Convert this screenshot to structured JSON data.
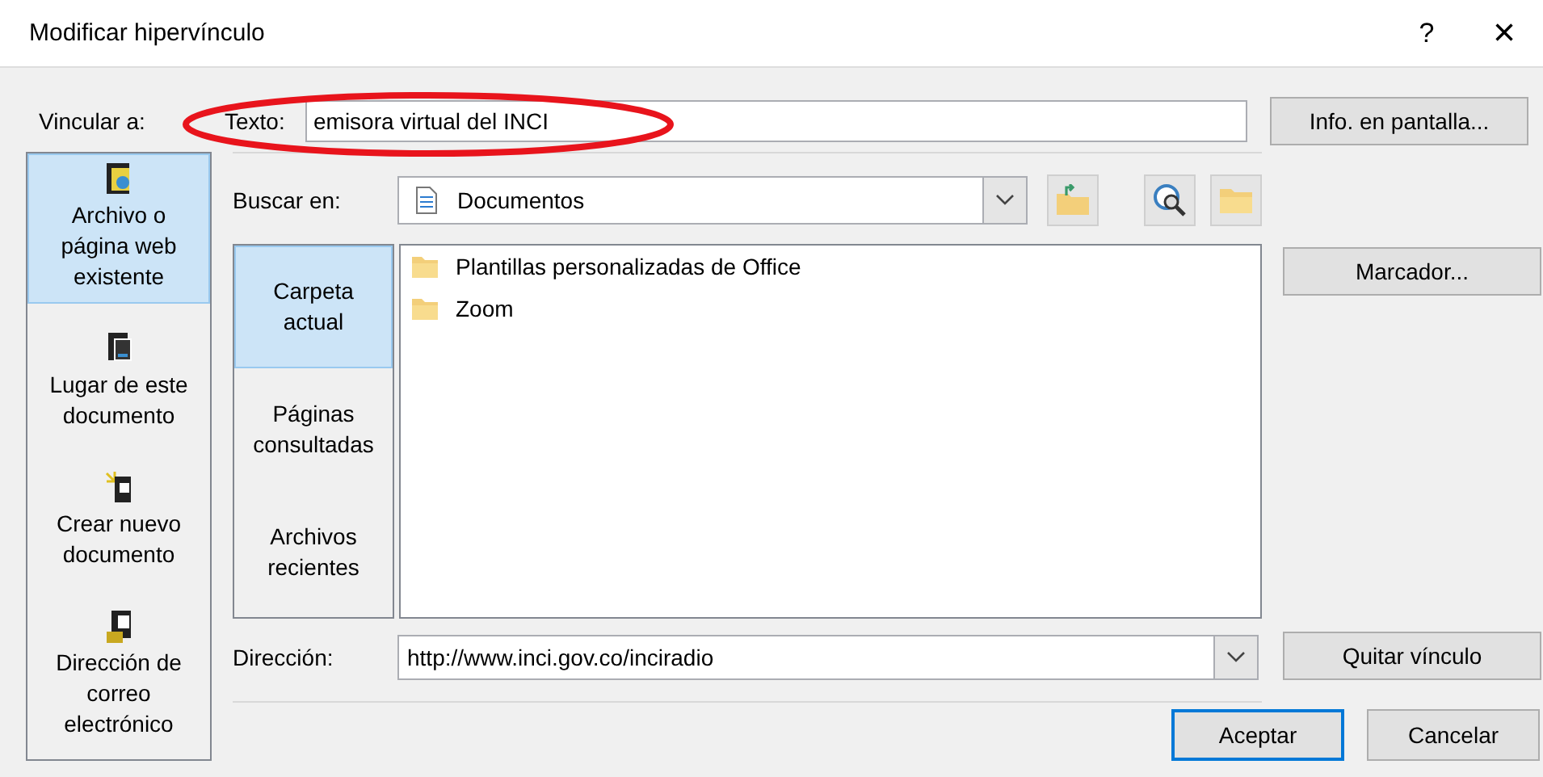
{
  "window": {
    "title": "Modificar hipervínculo",
    "help": "?",
    "close": "×"
  },
  "link_to": {
    "label": "Vincular a:",
    "items": [
      {
        "label": "Archivo o página web existente",
        "kind": "file",
        "selected": true
      },
      {
        "label": "Lugar de este documento",
        "kind": "place",
        "selected": false
      },
      {
        "label": "Crear nuevo documento",
        "kind": "new",
        "selected": false
      },
      {
        "label": "Dirección de correo electrónico",
        "kind": "mail",
        "selected": false
      }
    ]
  },
  "text_field": {
    "label": "Texto:",
    "value": "emisora virtual del INCI"
  },
  "screen_tip_button": "Info. en pantalla...",
  "look_in": {
    "label": "Buscar en:",
    "value": "Documentos"
  },
  "nav": [
    {
      "label": "Carpeta actual",
      "selected": true
    },
    {
      "label": "Páginas consultadas",
      "selected": false
    },
    {
      "label": "Archivos recientes",
      "selected": false
    }
  ],
  "files": [
    {
      "name": "Plantillas personalizadas de Office"
    },
    {
      "name": "Zoom"
    }
  ],
  "bookmark_button": "Marcador...",
  "address": {
    "label": "Dirección:",
    "value": "http://www.inci.gov.co/inciradio"
  },
  "remove_link_button": "Quitar vínculo",
  "buttons": [
    {
      "label": "Aceptar",
      "default": true
    },
    {
      "label": "Cancelar",
      "default": false
    }
  ]
}
